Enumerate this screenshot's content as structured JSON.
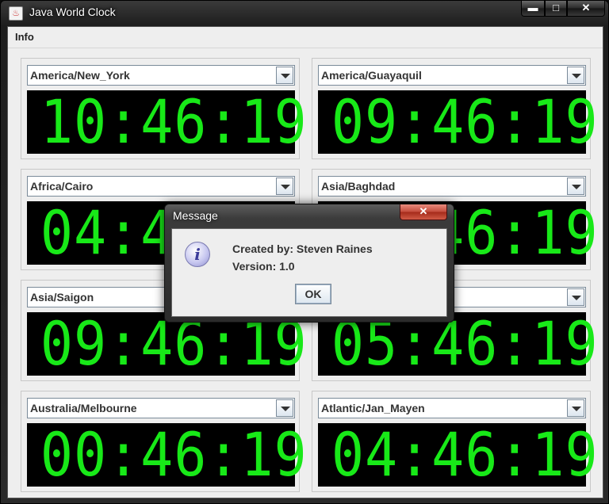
{
  "window": {
    "title": "Java World Clock",
    "app_icon": "java-icon"
  },
  "caption_buttons": {
    "minimize": "▬",
    "maximize": "□",
    "close": "✕"
  },
  "menu": {
    "info": "Info"
  },
  "clocks": [
    {
      "zone": "America/New_York",
      "time": "10:46:19"
    },
    {
      "zone": "America/Guayaquil",
      "time": "09:46:19"
    },
    {
      "zone": "Africa/Cairo",
      "time": "04:46:19"
    },
    {
      "zone": "Asia/Baghdad",
      "time": "06:46:19"
    },
    {
      "zone": "Asia/Saigon",
      "time": "09:46:19"
    },
    {
      "zone": "",
      "time": "05:46:19"
    },
    {
      "zone": "Australia/Melbourne",
      "time": "00:46:19"
    },
    {
      "zone": "Atlantic/Jan_Mayen",
      "time": "04:46:19"
    }
  ],
  "dialog": {
    "title": "Message",
    "close": "✕",
    "line1": "Created by: Steven Raines",
    "line2": "Version: 1.0",
    "ok": "OK",
    "icon": "info-icon",
    "icon_glyph": "i"
  },
  "colors": {
    "clock_digits": "#18e918",
    "clock_bg": "#000000",
    "close_button": "#c34a3a"
  }
}
